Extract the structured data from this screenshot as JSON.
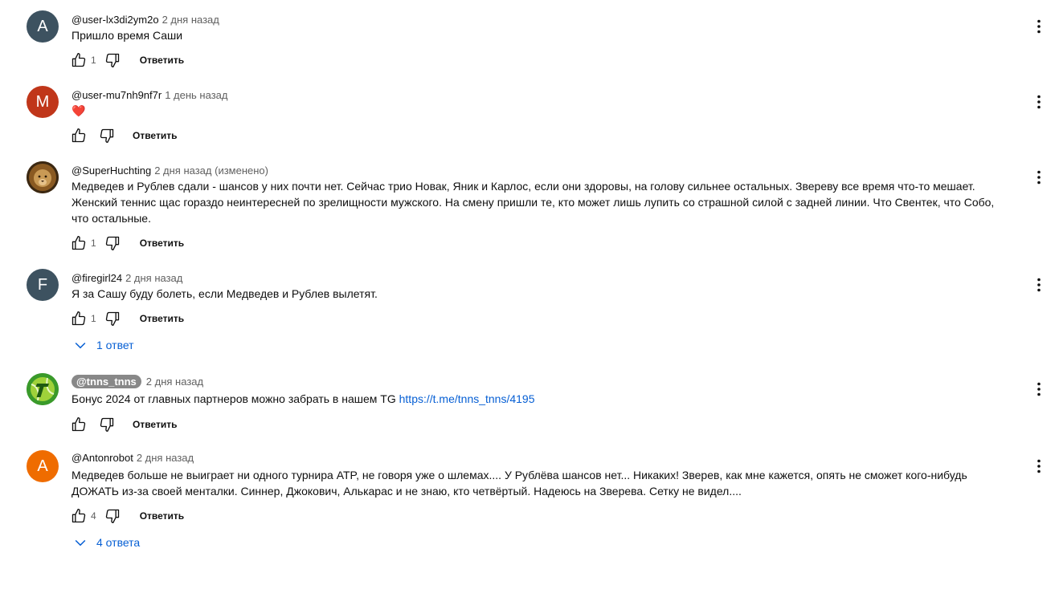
{
  "comments": [
    {
      "avatar_letter": "A",
      "avatar_color": "#3d5260",
      "author": "@user-lx3di2ym2o",
      "time": "2 дня назад",
      "text": "Пришло время Саши",
      "likes": "1",
      "reply_label": "Ответить"
    },
    {
      "avatar_letter": "M",
      "avatar_color": "#c0361a",
      "author": "@user-mu7nh9nf7r",
      "time": "1 день назад",
      "text": "❤️",
      "likes": "",
      "reply_label": "Ответить"
    },
    {
      "avatar_image": "lion-photo",
      "author": "@SuperHuchting",
      "time": "2 дня назад (изменено)",
      "text": "Медведев и Рублев сдали - шансов у них почти нет. Сейчас трио Новак, Яник и Карлос, если они здоровы, на голову сильнее остальных. Звереву все время что-то мешает. Женский теннис щас гораздо неинтересней по зрелищности мужского. На смену пришли те, кто может лишь лупить со страшной силой с задней линии. Что Свентек, что Собо, что остальные.",
      "likes": "1",
      "reply_label": "Ответить"
    },
    {
      "avatar_letter": "F",
      "avatar_color": "#3d5260",
      "author": "@firegirl24",
      "time": "2 дня назад",
      "text": "Я за Сашу буду болеть, если Медведев и Рублев вылетят.",
      "likes": "1",
      "reply_label": "Ответить",
      "replies_label": "1 ответ"
    },
    {
      "avatar_image": "tennis-ball-logo",
      "author": "@tnns_tnns",
      "time": "2 дня назад",
      "text": "Бонус 2024 от главных партнеров можно забрать в нашем TG ",
      "link": "https://t.me/tnns_tnns/4195",
      "likes": "",
      "reply_label": "Ответить"
    },
    {
      "avatar_letter": "A",
      "avatar_color": "#ef6c00",
      "author": "@Antonrobot",
      "time": "2 дня назад",
      "text": "Медведев больше не выиграет ни одного турнира ATP, не говоря уже о шлемах.... У Рублёва шансов нет... Никаких! Зверев, как мне кажется, опять не сможет кого-нибудь ДОЖАТЬ из-за своей менталки. Синнер, Джокович, Алькарас и не знаю, кто четвёртый. Надеюсь на Зверева. Сетку не видел....",
      "likes": "4",
      "reply_label": "Ответить",
      "replies_label": "4 ответа"
    }
  ],
  "icons": {
    "like": "thumb-up-icon",
    "dislike": "thumb-down-icon",
    "menu": "more-vertical-icon",
    "expand": "chevron-down-icon"
  },
  "colors": {
    "link": "#065fd4",
    "meta": "#606060"
  }
}
